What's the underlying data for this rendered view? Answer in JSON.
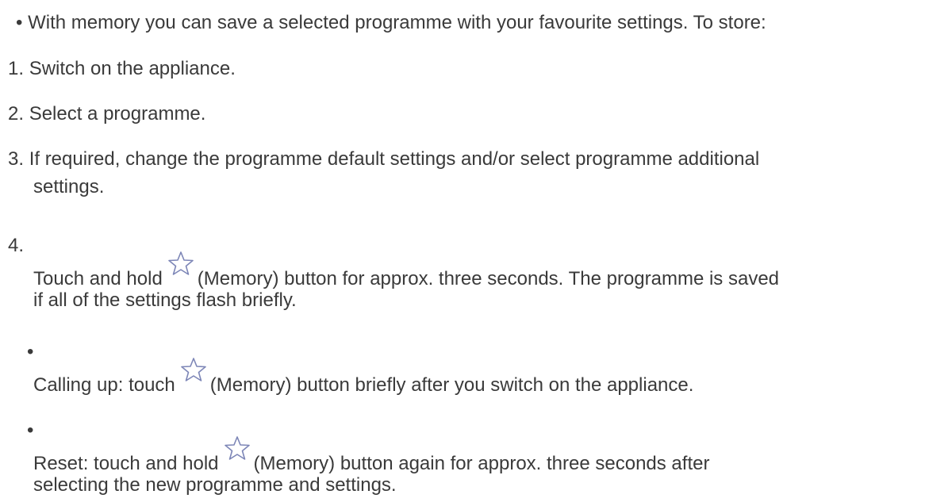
{
  "intro": {
    "bullet": "•",
    "text": "With memory you can save a selected programme with your favourite settings. To store:"
  },
  "steps": [
    {
      "number": "1.",
      "text": "Switch on the appliance."
    },
    {
      "number": "2.",
      "text": "Select a programme."
    },
    {
      "number": "3.",
      "line1": "If required, change the programme default settings and/or select programme additional",
      "line2": "settings."
    },
    {
      "number": "4.",
      "before": "Touch and hold",
      "after": "(Memory) button for approx. three seconds. The programme is saved",
      "line2": "if all of the settings flash briefly."
    }
  ],
  "notes": [
    {
      "bullet": "•",
      "before": "Calling up: touch",
      "after": "(Memory) button briefly after you switch on the appliance."
    },
    {
      "bullet": "•",
      "before": "Reset: touch and hold",
      "after": "(Memory) button again for approx. three seconds after",
      "line2": "selecting the new programme and settings."
    }
  ],
  "icons": {
    "memory": "star-outline-icon",
    "color": "#7d86b7"
  }
}
